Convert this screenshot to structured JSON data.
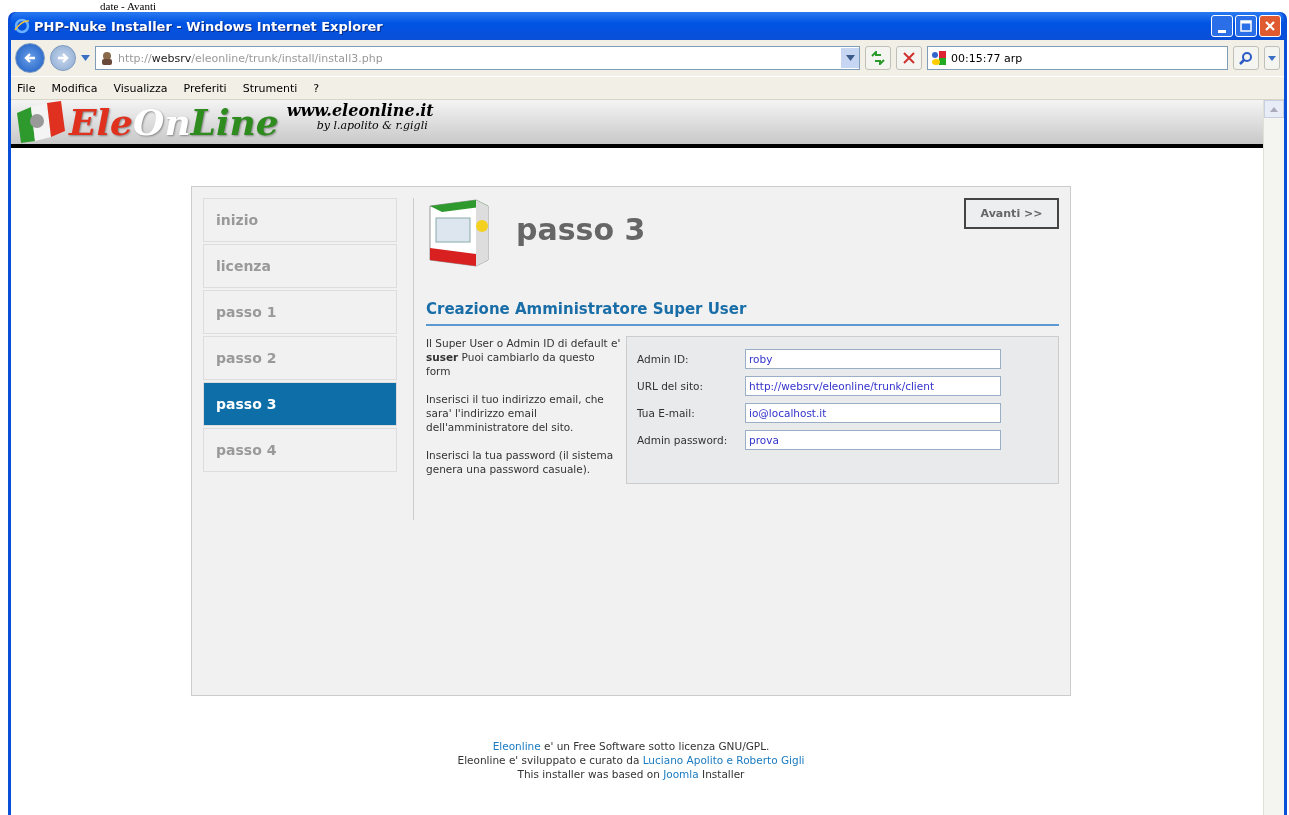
{
  "doc_caption": "date - Avanti",
  "browser": {
    "title": "PHP-Nuke Installer - Windows Internet Explorer",
    "address": {
      "scheme": "http://",
      "host": "websrv",
      "path": "/eleonline/trunk/install/install3.php"
    },
    "search": {
      "value": "00:15:77 arp"
    },
    "menu": [
      "File",
      "Modifica",
      "Visualizza",
      "Preferiti",
      "Strumenti",
      "?"
    ]
  },
  "banner": {
    "logo": [
      {
        "text": "Ele",
        "color": "#e0301e"
      },
      {
        "text": "On",
        "color": "#ffffff"
      },
      {
        "text": "Line",
        "color": "#2e8b1e"
      }
    ],
    "site": "www.eleonline.it",
    "byline": "by l.apolito & r.gigli"
  },
  "steps": [
    {
      "label": "inizio",
      "selected": false
    },
    {
      "label": "licenza",
      "selected": false
    },
    {
      "label": "passo 1",
      "selected": false
    },
    {
      "label": "passo 2",
      "selected": false
    },
    {
      "label": "passo 3",
      "selected": true
    },
    {
      "label": "passo 4",
      "selected": false
    }
  ],
  "page_title": "passo 3",
  "next_button": "Avanti >>",
  "section_title": "Creazione Amministratore Super User",
  "help": [
    "Il Super User o Admin ID di default e' **suser** Puoi cambiarlo da questo form",
    "Inserisci il tuo indirizzo email, che sara' l'indirizzo email dell'amministratore del sito.",
    "Inserisci la tua password (il sistema genera una password casuale)."
  ],
  "form": [
    {
      "label": "Admin ID:",
      "value": "roby"
    },
    {
      "label": "URL del sito:",
      "value": "http://websrv/eleonline/trunk/client"
    },
    {
      "label": "Tua E-mail:",
      "value": "io@localhost.it"
    },
    {
      "label": "Admin password:",
      "value": "prova"
    }
  ],
  "footer": [
    [
      {
        "text": "Eleonline",
        "link": true
      },
      {
        "text": "e' un Free Software sotto licenza GNU/GPL.",
        "link": false
      }
    ],
    [
      {
        "text": "Eleonline e' sviluppato e curato da",
        "link": false
      },
      {
        "text": "Luciano Apolito e Roberto Gigli",
        "link": true
      }
    ],
    [
      {
        "text": "This installer was based on",
        "link": false
      },
      {
        "text": "Joomla",
        "link": true
      },
      {
        "text": "Installer",
        "link": false
      }
    ]
  ]
}
